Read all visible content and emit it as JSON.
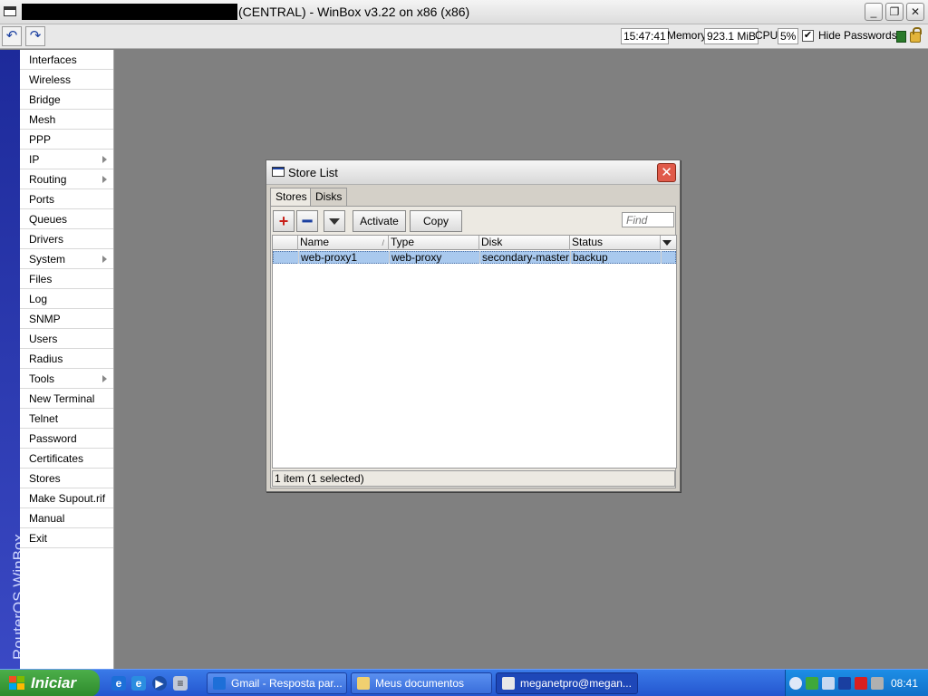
{
  "window": {
    "title": "(CENTRAL) - WinBox v3.22 on x86 (x86)",
    "minimize": "_",
    "restore": "❐",
    "close": "✕"
  },
  "toolbar": {
    "undo": "↶",
    "redo": "↷",
    "time": "15:47:41",
    "memory_label": "Memory:",
    "memory_value": "923.1 MiB",
    "cpu_label": "CPU:",
    "cpu_value": "5%",
    "hide_passwords_checked": "✔",
    "hide_passwords_label": "Hide Passwords"
  },
  "sidebar": {
    "brand": "RouterOS WinBox",
    "items": [
      {
        "label": "Interfaces",
        "submenu": false
      },
      {
        "label": "Wireless",
        "submenu": false
      },
      {
        "label": "Bridge",
        "submenu": false
      },
      {
        "label": "Mesh",
        "submenu": false
      },
      {
        "label": "PPP",
        "submenu": false
      },
      {
        "label": "IP",
        "submenu": true
      },
      {
        "label": "Routing",
        "submenu": true
      },
      {
        "label": "Ports",
        "submenu": false
      },
      {
        "label": "Queues",
        "submenu": false
      },
      {
        "label": "Drivers",
        "submenu": false
      },
      {
        "label": "System",
        "submenu": true
      },
      {
        "label": "Files",
        "submenu": false
      },
      {
        "label": "Log",
        "submenu": false
      },
      {
        "label": "SNMP",
        "submenu": false
      },
      {
        "label": "Users",
        "submenu": false
      },
      {
        "label": "Radius",
        "submenu": false
      },
      {
        "label": "Tools",
        "submenu": true
      },
      {
        "label": "New Terminal",
        "submenu": false
      },
      {
        "label": "Telnet",
        "submenu": false
      },
      {
        "label": "Password",
        "submenu": false
      },
      {
        "label": "Certificates",
        "submenu": false
      },
      {
        "label": "Stores",
        "submenu": false
      },
      {
        "label": "Make Supout.rif",
        "submenu": false
      },
      {
        "label": "Manual",
        "submenu": false
      },
      {
        "label": "Exit",
        "submenu": false
      }
    ]
  },
  "dialog": {
    "title": "Store List",
    "close": "✕",
    "tabs": [
      "Stores",
      "Disks"
    ],
    "active_tab": "Stores",
    "buttons": {
      "add": "+",
      "remove": "━",
      "activate": "Activate",
      "copy": "Copy"
    },
    "find_placeholder": "Find",
    "columns": [
      "Name",
      "Type",
      "Disk",
      "Status"
    ],
    "sort_indicator": "/",
    "rows": [
      {
        "name": "web-proxy1",
        "type": "web-proxy",
        "disk": "secondary-master",
        "status": "backup"
      }
    ],
    "status": "1 item (1 selected)"
  },
  "taskbar": {
    "start_label": "Iniciar",
    "tasks": [
      {
        "label": "Gmail - Resposta par...",
        "active": false
      },
      {
        "label": "Meus documentos",
        "active": false
      },
      {
        "label": "meganetpro@megan...",
        "active": true
      }
    ],
    "clock": "08:41"
  },
  "colors": {
    "sidebar_strip": "#2a37b0",
    "workspace": "#808080",
    "selected_row": "#a9c9ee",
    "taskbar": "#2f63d6",
    "start_button": "#3c9e3a"
  }
}
